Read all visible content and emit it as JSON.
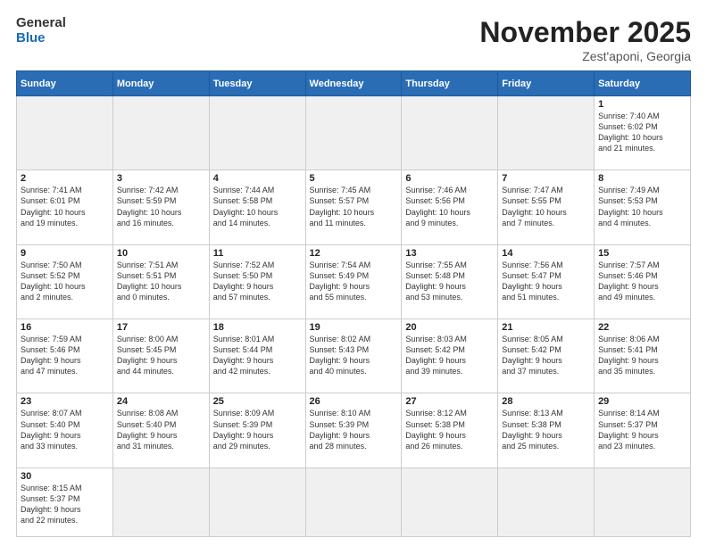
{
  "header": {
    "logo_general": "General",
    "logo_blue": "Blue",
    "month_title": "November 2025",
    "subtitle": "Zest'aponi, Georgia"
  },
  "weekdays": [
    "Sunday",
    "Monday",
    "Tuesday",
    "Wednesday",
    "Thursday",
    "Friday",
    "Saturday"
  ],
  "weeks": [
    [
      {
        "day": "",
        "info": "",
        "empty": true
      },
      {
        "day": "",
        "info": "",
        "empty": true
      },
      {
        "day": "",
        "info": "",
        "empty": true
      },
      {
        "day": "",
        "info": "",
        "empty": true
      },
      {
        "day": "",
        "info": "",
        "empty": true
      },
      {
        "day": "",
        "info": "",
        "empty": true
      },
      {
        "day": "1",
        "info": "Sunrise: 7:40 AM\nSunset: 6:02 PM\nDaylight: 10 hours\nand 21 minutes.",
        "empty": false
      }
    ],
    [
      {
        "day": "2",
        "info": "Sunrise: 7:41 AM\nSunset: 6:01 PM\nDaylight: 10 hours\nand 19 minutes.",
        "empty": false
      },
      {
        "day": "3",
        "info": "Sunrise: 7:42 AM\nSunset: 5:59 PM\nDaylight: 10 hours\nand 16 minutes.",
        "empty": false
      },
      {
        "day": "4",
        "info": "Sunrise: 7:44 AM\nSunset: 5:58 PM\nDaylight: 10 hours\nand 14 minutes.",
        "empty": false
      },
      {
        "day": "5",
        "info": "Sunrise: 7:45 AM\nSunset: 5:57 PM\nDaylight: 10 hours\nand 11 minutes.",
        "empty": false
      },
      {
        "day": "6",
        "info": "Sunrise: 7:46 AM\nSunset: 5:56 PM\nDaylight: 10 hours\nand 9 minutes.",
        "empty": false
      },
      {
        "day": "7",
        "info": "Sunrise: 7:47 AM\nSunset: 5:55 PM\nDaylight: 10 hours\nand 7 minutes.",
        "empty": false
      },
      {
        "day": "8",
        "info": "Sunrise: 7:49 AM\nSunset: 5:53 PM\nDaylight: 10 hours\nand 4 minutes.",
        "empty": false
      }
    ],
    [
      {
        "day": "9",
        "info": "Sunrise: 7:50 AM\nSunset: 5:52 PM\nDaylight: 10 hours\nand 2 minutes.",
        "empty": false
      },
      {
        "day": "10",
        "info": "Sunrise: 7:51 AM\nSunset: 5:51 PM\nDaylight: 10 hours\nand 0 minutes.",
        "empty": false
      },
      {
        "day": "11",
        "info": "Sunrise: 7:52 AM\nSunset: 5:50 PM\nDaylight: 9 hours\nand 57 minutes.",
        "empty": false
      },
      {
        "day": "12",
        "info": "Sunrise: 7:54 AM\nSunset: 5:49 PM\nDaylight: 9 hours\nand 55 minutes.",
        "empty": false
      },
      {
        "day": "13",
        "info": "Sunrise: 7:55 AM\nSunset: 5:48 PM\nDaylight: 9 hours\nand 53 minutes.",
        "empty": false
      },
      {
        "day": "14",
        "info": "Sunrise: 7:56 AM\nSunset: 5:47 PM\nDaylight: 9 hours\nand 51 minutes.",
        "empty": false
      },
      {
        "day": "15",
        "info": "Sunrise: 7:57 AM\nSunset: 5:46 PM\nDaylight: 9 hours\nand 49 minutes.",
        "empty": false
      }
    ],
    [
      {
        "day": "16",
        "info": "Sunrise: 7:59 AM\nSunset: 5:46 PM\nDaylight: 9 hours\nand 47 minutes.",
        "empty": false
      },
      {
        "day": "17",
        "info": "Sunrise: 8:00 AM\nSunset: 5:45 PM\nDaylight: 9 hours\nand 44 minutes.",
        "empty": false
      },
      {
        "day": "18",
        "info": "Sunrise: 8:01 AM\nSunset: 5:44 PM\nDaylight: 9 hours\nand 42 minutes.",
        "empty": false
      },
      {
        "day": "19",
        "info": "Sunrise: 8:02 AM\nSunset: 5:43 PM\nDaylight: 9 hours\nand 40 minutes.",
        "empty": false
      },
      {
        "day": "20",
        "info": "Sunrise: 8:03 AM\nSunset: 5:42 PM\nDaylight: 9 hours\nand 39 minutes.",
        "empty": false
      },
      {
        "day": "21",
        "info": "Sunrise: 8:05 AM\nSunset: 5:42 PM\nDaylight: 9 hours\nand 37 minutes.",
        "empty": false
      },
      {
        "day": "22",
        "info": "Sunrise: 8:06 AM\nSunset: 5:41 PM\nDaylight: 9 hours\nand 35 minutes.",
        "empty": false
      }
    ],
    [
      {
        "day": "23",
        "info": "Sunrise: 8:07 AM\nSunset: 5:40 PM\nDaylight: 9 hours\nand 33 minutes.",
        "empty": false
      },
      {
        "day": "24",
        "info": "Sunrise: 8:08 AM\nSunset: 5:40 PM\nDaylight: 9 hours\nand 31 minutes.",
        "empty": false
      },
      {
        "day": "25",
        "info": "Sunrise: 8:09 AM\nSunset: 5:39 PM\nDaylight: 9 hours\nand 29 minutes.",
        "empty": false
      },
      {
        "day": "26",
        "info": "Sunrise: 8:10 AM\nSunset: 5:39 PM\nDaylight: 9 hours\nand 28 minutes.",
        "empty": false
      },
      {
        "day": "27",
        "info": "Sunrise: 8:12 AM\nSunset: 5:38 PM\nDaylight: 9 hours\nand 26 minutes.",
        "empty": false
      },
      {
        "day": "28",
        "info": "Sunrise: 8:13 AM\nSunset: 5:38 PM\nDaylight: 9 hours\nand 25 minutes.",
        "empty": false
      },
      {
        "day": "29",
        "info": "Sunrise: 8:14 AM\nSunset: 5:37 PM\nDaylight: 9 hours\nand 23 minutes.",
        "empty": false
      }
    ],
    [
      {
        "day": "30",
        "info": "Sunrise: 8:15 AM\nSunset: 5:37 PM\nDaylight: 9 hours\nand 22 minutes.",
        "empty": false
      },
      {
        "day": "",
        "info": "",
        "empty": true
      },
      {
        "day": "",
        "info": "",
        "empty": true
      },
      {
        "day": "",
        "info": "",
        "empty": true
      },
      {
        "day": "",
        "info": "",
        "empty": true
      },
      {
        "day": "",
        "info": "",
        "empty": true
      },
      {
        "day": "",
        "info": "",
        "empty": true
      }
    ]
  ]
}
